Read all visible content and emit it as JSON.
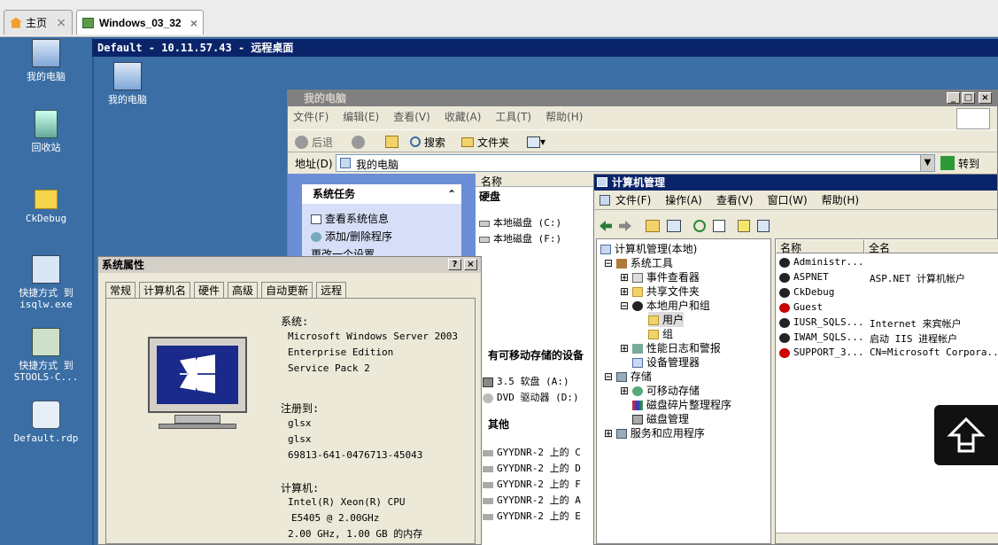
{
  "browser": {
    "tabs": [
      {
        "label": "主页",
        "close": "×"
      },
      {
        "label": "Windows_03_32",
        "close": "×"
      }
    ]
  },
  "local_desktop": {
    "icons": [
      {
        "label": "我的电脑"
      },
      {
        "label": "回收站"
      },
      {
        "label": "CkDebug"
      },
      {
        "label": "快捷方式 到 isqlw.exe"
      },
      {
        "label": "快捷方式 到 STOOLS-C..."
      },
      {
        "label": "Default.rdp"
      }
    ]
  },
  "rdp": {
    "title": "Default - 10.11.57.43 - 远程桌面",
    "desktop_icon": "我的电脑"
  },
  "mycomputer": {
    "title": "我的电脑",
    "menu": [
      "文件(F)",
      "编辑(E)",
      "查看(V)",
      "收藏(A)",
      "工具(T)",
      "帮助(H)"
    ],
    "toolbar": {
      "back": "后退",
      "search": "搜索",
      "folders": "文件夹"
    },
    "address_label": "地址(D)",
    "address_value": "我的电脑",
    "go": "转到",
    "tasks_header": "系统任务",
    "tasks": [
      "查看系统信息",
      "添加/删除程序",
      "更改一个设置"
    ],
    "col_name": "名称",
    "groups": {
      "hdd": "硬盘",
      "removable": "有可移动存储的设备",
      "other": "其他"
    },
    "hdd_items": [
      "本地磁盘 (C:)",
      "本地磁盘 (F:)"
    ],
    "removable_items": [
      "3.5 软盘 (A:)",
      "DVD 驱动器 (D:)"
    ],
    "other_items": [
      "GYYDNR-2 上的 C",
      "GYYDNR-2 上的 D",
      "GYYDNR-2 上的 F",
      "GYYDNR-2 上的 A",
      "GYYDNR-2 上的 E"
    ]
  },
  "sysprops": {
    "title": "系统属性",
    "tabs": [
      "常规",
      "计算机名",
      "硬件",
      "高级",
      "自动更新",
      "远程"
    ],
    "system_label": "系统:",
    "system_lines": [
      "Microsoft Windows Server 2003",
      "Enterprise Edition",
      "Service Pack 2"
    ],
    "registered_label": "注册到:",
    "registered_lines": [
      "glsx",
      "glsx",
      "69813-641-0476713-45043"
    ],
    "computer_label": "计算机:",
    "computer_lines": [
      "Intel(R) Xeon(R) CPU",
      "E5405  @ 2.00GHz",
      "2.00 GHz, 1.00 GB 的内存"
    ]
  },
  "compmgmt": {
    "title": "计算机管理",
    "menu": [
      "文件(F)",
      "操作(A)",
      "查看(V)",
      "窗口(W)",
      "帮助(H)"
    ],
    "tree": [
      {
        "label": "计算机管理(本地)",
        "indent": 0
      },
      {
        "label": "系统工具",
        "indent": 1
      },
      {
        "label": "事件查看器",
        "indent": 2
      },
      {
        "label": "共享文件夹",
        "indent": 2
      },
      {
        "label": "本地用户和组",
        "indent": 2
      },
      {
        "label": "用户",
        "indent": 3
      },
      {
        "label": "组",
        "indent": 3
      },
      {
        "label": "性能日志和警报",
        "indent": 2
      },
      {
        "label": "设备管理器",
        "indent": 2
      },
      {
        "label": "存储",
        "indent": 1
      },
      {
        "label": "可移动存储",
        "indent": 2
      },
      {
        "label": "磁盘碎片整理程序",
        "indent": 2
      },
      {
        "label": "磁盘管理",
        "indent": 2
      },
      {
        "label": "服务和应用程序",
        "indent": 1
      }
    ],
    "col_name": "名称",
    "col_fullname": "全名",
    "users": [
      {
        "name": "Administr...",
        "full": "",
        "disabled": false
      },
      {
        "name": "ASPNET",
        "full": "ASP.NET 计算机帐户",
        "disabled": false
      },
      {
        "name": "CkDebug",
        "full": "",
        "disabled": false
      },
      {
        "name": "Guest",
        "full": "",
        "disabled": true
      },
      {
        "name": "IUSR_SQLS...",
        "full": "Internet 来宾帐户",
        "disabled": false
      },
      {
        "name": "IWAM_SQLS...",
        "full": "启动 IIS 进程帐户",
        "disabled": false
      },
      {
        "name": "SUPPORT_3...",
        "full": "CN=Microsoft Corpora...",
        "disabled": true
      }
    ]
  },
  "colors": {
    "titlebar": "#0a246a",
    "desktop": "#3a6ea5",
    "window": "#ece9d8"
  }
}
